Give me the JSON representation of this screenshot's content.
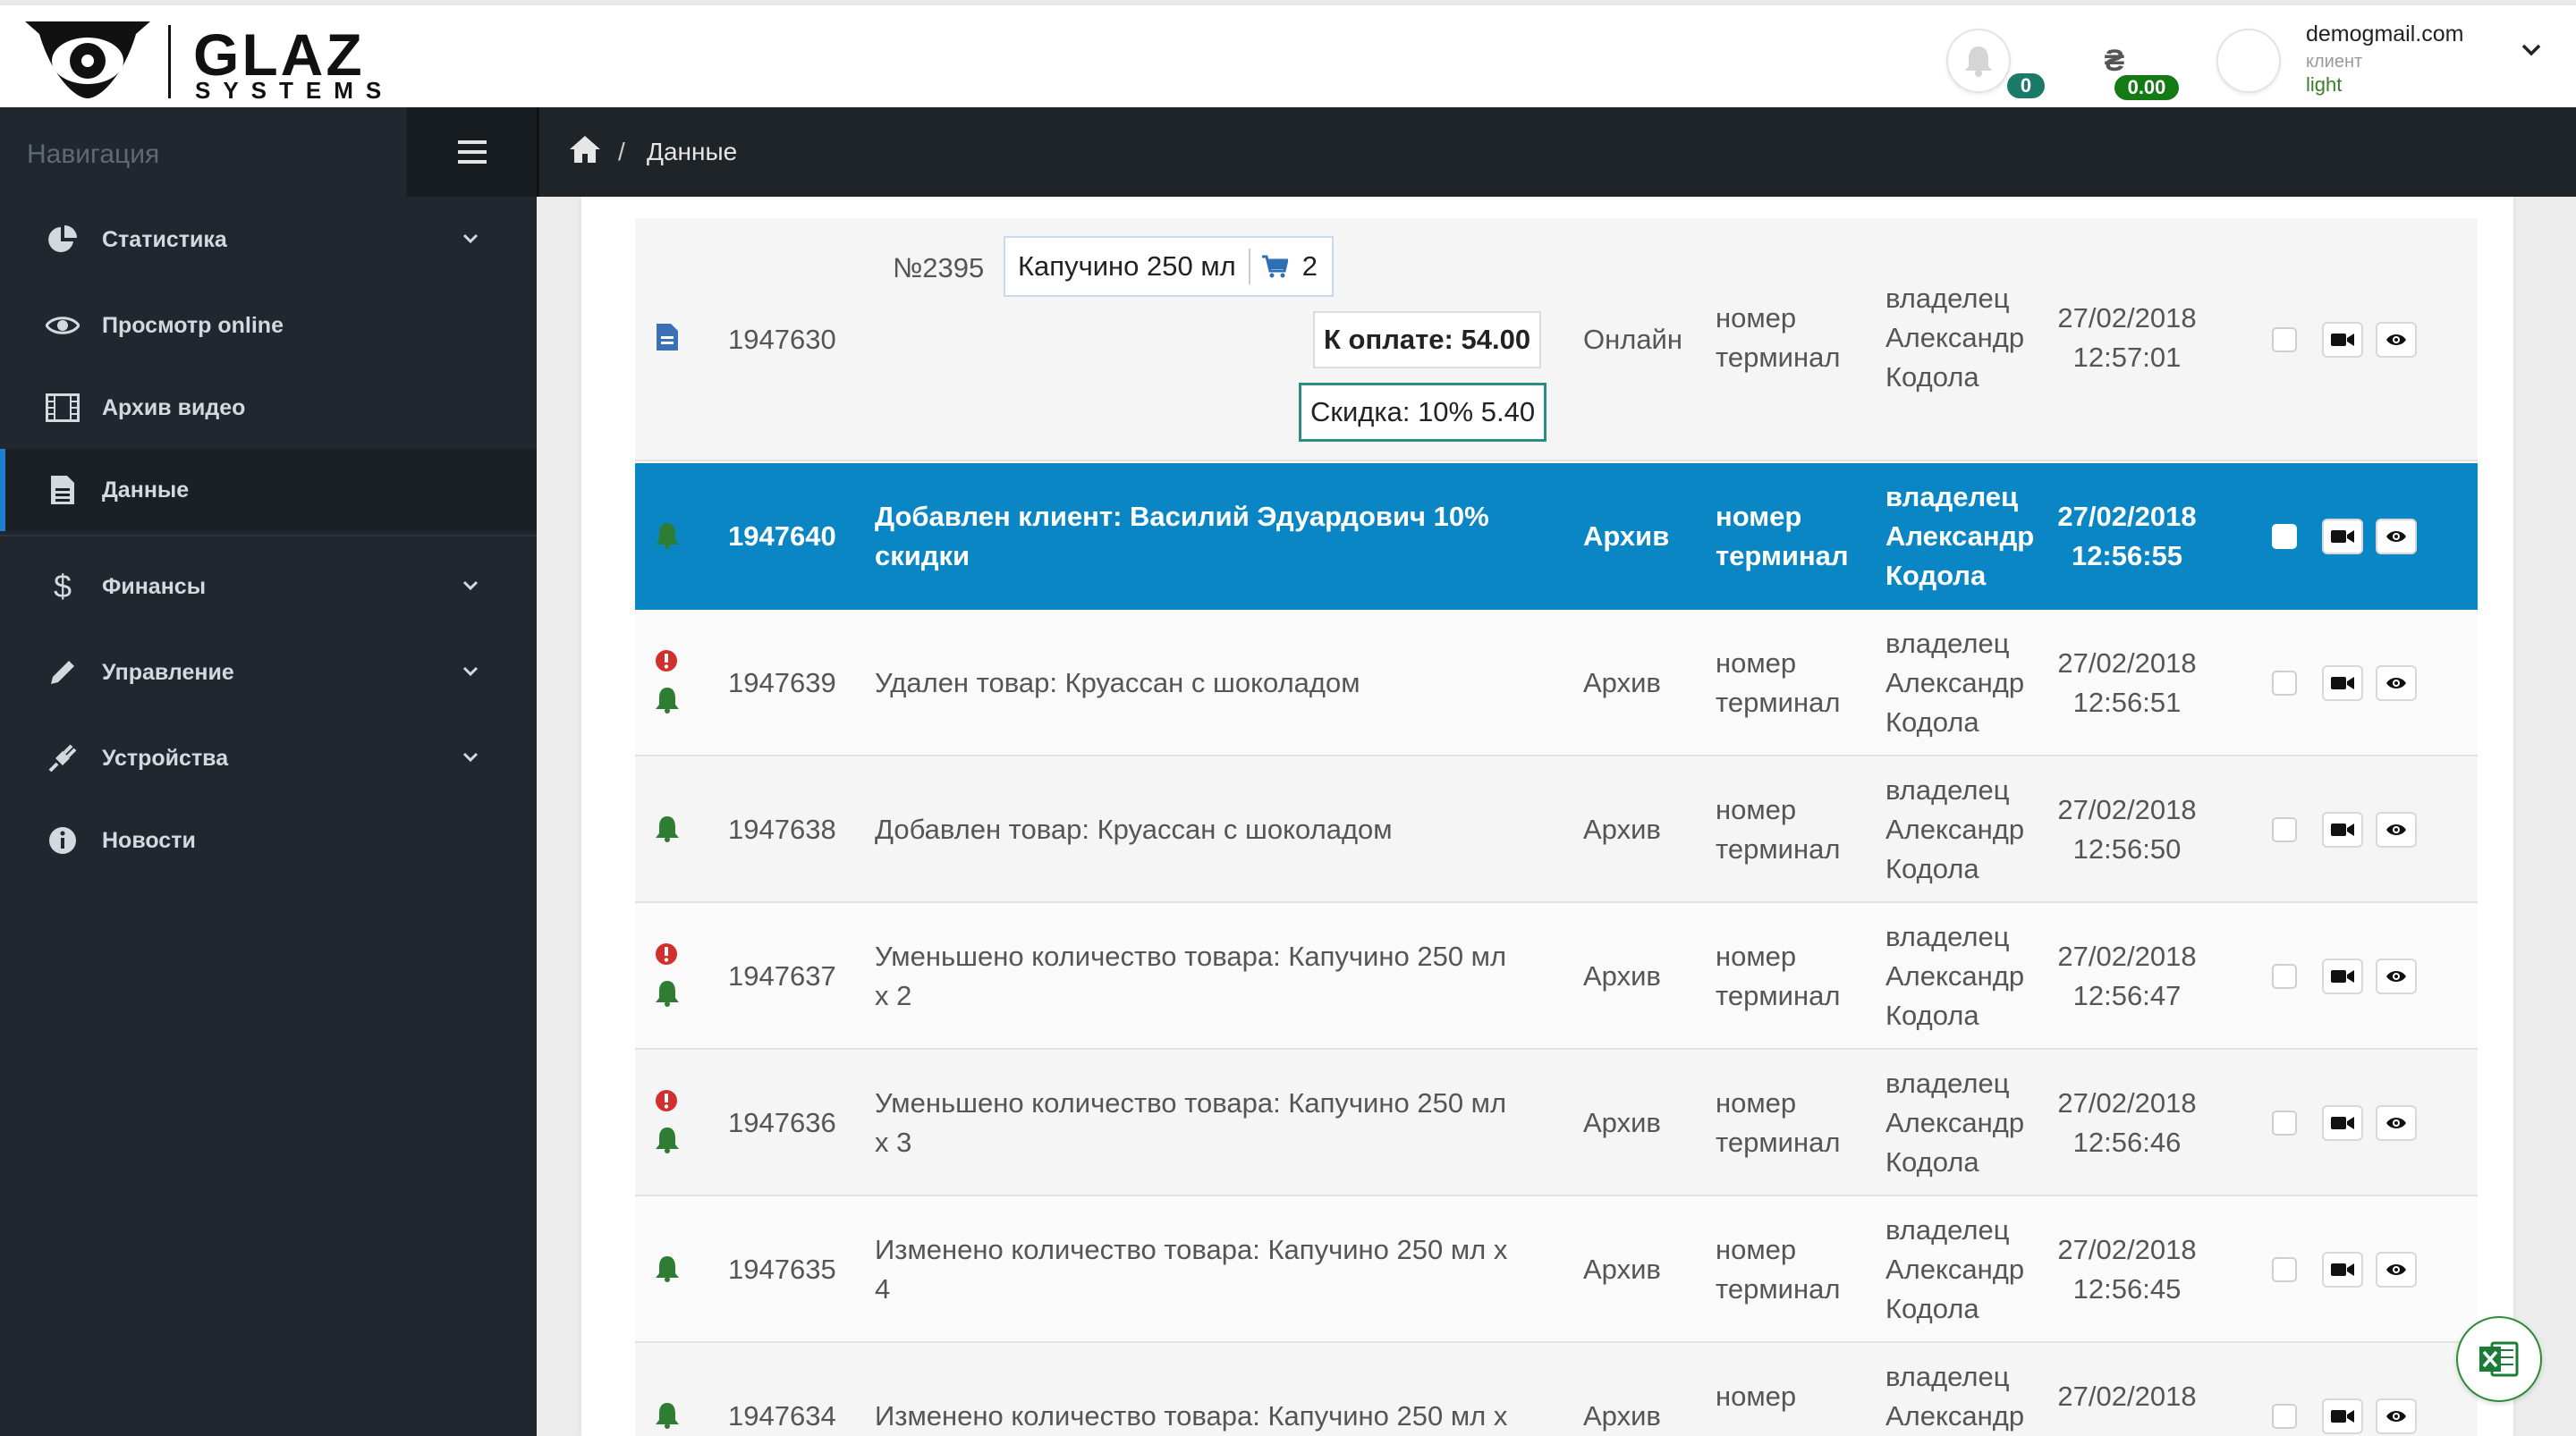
{
  "header": {
    "brand": "GLAZ",
    "brand_sub": "SYSTEMS",
    "notifications_count": "0",
    "balance": "0.00",
    "user_email": "demogmail.com",
    "user_role": "клиент",
    "user_plan": "light"
  },
  "sidebar": {
    "title": "Навигация",
    "items": [
      {
        "label": "Статистика",
        "icon": "pie-chart-icon",
        "expandable": true
      },
      {
        "label": "Просмотр online",
        "icon": "eye-icon",
        "expandable": false
      },
      {
        "label": "Архив видео",
        "icon": "film-icon",
        "expandable": false
      },
      {
        "label": "Данные",
        "icon": "file-icon",
        "expandable": false,
        "active": true
      },
      {
        "label": "Финансы",
        "icon": "dollar-icon",
        "expandable": true
      },
      {
        "label": "Управление",
        "icon": "pencil-icon",
        "expandable": true
      },
      {
        "label": "Устройства",
        "icon": "plug-icon",
        "expandable": true
      },
      {
        "label": "Новости",
        "icon": "info-icon",
        "expandable": false
      }
    ]
  },
  "breadcrumb": {
    "current": "Данные"
  },
  "order": {
    "id": "1947630",
    "number": "№2395",
    "item": "Капучино 250 мл",
    "qty": "2",
    "pay": "К оплате: 54.00",
    "discount": "Скидка: 10% 5.40",
    "source": "Онлайн",
    "terminal": [
      "номер",
      "терминал"
    ],
    "user": [
      "владелец",
      "Александр",
      "Кодола"
    ],
    "date": "27/02/2018",
    "time": "12:57:01"
  },
  "rows": [
    {
      "id": "1947640",
      "desc": [
        "Добавлен клиент: Василий Эдуардович 10%",
        "скидки"
      ],
      "source": "Архив",
      "terminal": [
        "номер",
        "терминал"
      ],
      "user": [
        "владелец",
        "Александр",
        "Кодола"
      ],
      "date": "27/02/2018",
      "time": "12:56:55",
      "warn": false
    },
    {
      "id": "1947639",
      "desc": [
        "Удален товар: Круассан с шоколадом"
      ],
      "source": "Архив",
      "terminal": [
        "номер",
        "терминал"
      ],
      "user": [
        "владелец",
        "Александр",
        "Кодола"
      ],
      "date": "27/02/2018",
      "time": "12:56:51",
      "warn": true
    },
    {
      "id": "1947638",
      "desc": [
        "Добавлен товар: Круассан с шоколадом"
      ],
      "source": "Архив",
      "terminal": [
        "номер",
        "терминал"
      ],
      "user": [
        "владелец",
        "Александр",
        "Кодола"
      ],
      "date": "27/02/2018",
      "time": "12:56:50",
      "warn": false
    },
    {
      "id": "1947637",
      "desc": [
        "Уменьшено количество товара: Капучино 250 мл",
        "x 2"
      ],
      "source": "Архив",
      "terminal": [
        "номер",
        "терминал"
      ],
      "user": [
        "владелец",
        "Александр",
        "Кодола"
      ],
      "date": "27/02/2018",
      "time": "12:56:47",
      "warn": true
    },
    {
      "id": "1947636",
      "desc": [
        "Уменьшено количество товара: Капучино 250 мл",
        "x 3"
      ],
      "source": "Архив",
      "terminal": [
        "номер",
        "терминал"
      ],
      "user": [
        "владелец",
        "Александр",
        "Кодола"
      ],
      "date": "27/02/2018",
      "time": "12:56:46",
      "warn": true
    },
    {
      "id": "1947635",
      "desc": [
        "Изменено количество товара: Капучино 250 мл x",
        "4"
      ],
      "source": "Архив",
      "terminal": [
        "номер",
        "терминал"
      ],
      "user": [
        "владелец",
        "Александр",
        "Кодола"
      ],
      "date": "27/02/2018",
      "time": "12:56:45",
      "warn": false
    },
    {
      "id": "1947634",
      "desc": [
        "Изменено количество товара: Капучино 250 мл x"
      ],
      "source": "Архив",
      "terminal": [
        "номер"
      ],
      "user": [
        "владелец",
        "Александр"
      ],
      "date": "27/02/2018",
      "time": "",
      "warn": false
    }
  ],
  "colors": {
    "accent": "#0b86c5",
    "sidebar_bg": "#20272e",
    "bell_green": "#2e7d32",
    "warn_red": "#d32f2f"
  }
}
